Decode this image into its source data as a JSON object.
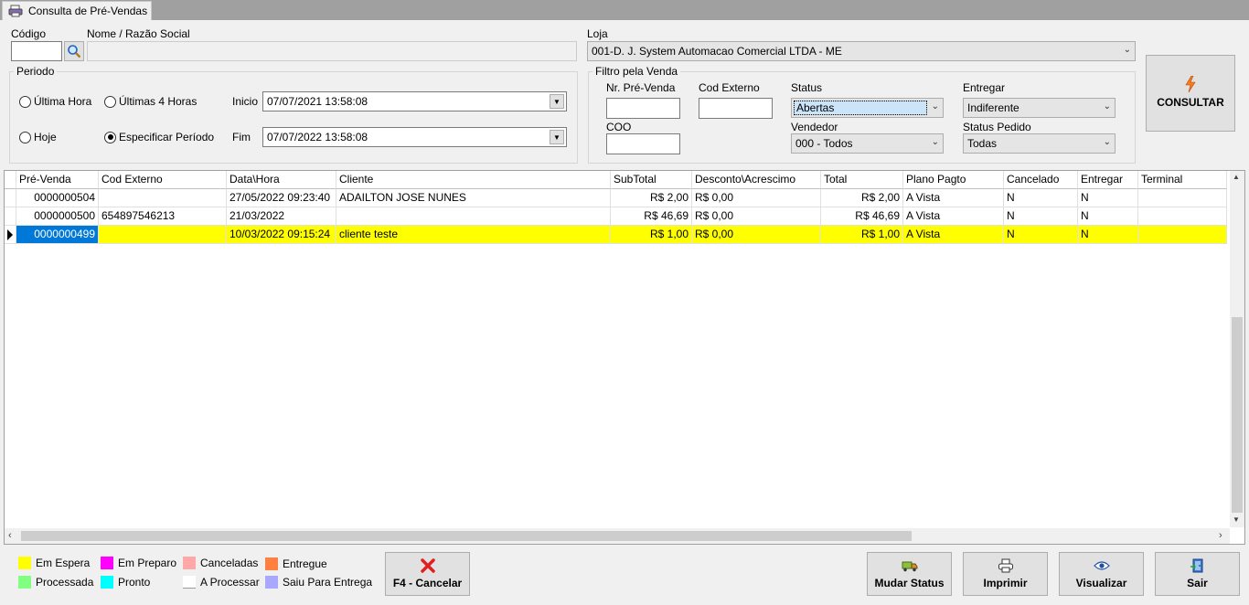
{
  "tab": {
    "title": "Consulta de  Pré-Vendas"
  },
  "codigo": {
    "label": "Código",
    "value": ""
  },
  "nome": {
    "label": "Nome / Razão Social",
    "value": ""
  },
  "loja": {
    "label": "Loja",
    "value": "001-D. J. System Automacao Comercial LTDA - ME"
  },
  "periodo": {
    "title": "Periodo",
    "options": [
      "Última Hora",
      "Últimas 4 Horas",
      "Hoje",
      "Especificar Período"
    ],
    "selected": "Especificar Período",
    "inicio_label": "Inicio",
    "inicio_value": "07/07/2021    13:58:08",
    "fim_label": "Fim",
    "fim_value": "07/07/2022    13:58:08"
  },
  "filtro": {
    "title": "Filtro pela Venda",
    "nr_label": "Nr. Pré-Venda",
    "nr_value": "",
    "codext_label": "Cod Externo",
    "codext_value": "",
    "coo_label": "COO",
    "coo_value": "",
    "status_label": "Status",
    "status_value": "Abertas",
    "vendedor_label": "Vendedor",
    "vendedor_value": "000 - Todos",
    "entregar_label": "Entregar",
    "entregar_value": "Indiferente",
    "statuspedido_label": "Status Pedido",
    "statuspedido_value": "Todas"
  },
  "consultar_label": "CONSULTAR",
  "grid": {
    "columns": [
      "Pré-Venda",
      "Cod Externo",
      "Data\\Hora",
      "Cliente",
      "SubTotal",
      "Desconto\\Acrescimo",
      "Total",
      "Plano Pagto",
      "Cancelado",
      "Entregar",
      "Terminal"
    ],
    "rows": [
      [
        "0000000504",
        "",
        "27/05/2022 09:23:40",
        "ADAILTON JOSE NUNES",
        "R$ 2,00",
        "R$ 0,00",
        "R$ 2,00",
        "A Vista",
        "N",
        "N",
        ""
      ],
      [
        "0000000500",
        "654897546213",
        "21/03/2022",
        "",
        "R$ 46,69",
        "R$ 0,00",
        "R$ 46,69",
        "A Vista",
        "N",
        "N",
        ""
      ],
      [
        "0000000499",
        "",
        "10/03/2022 09:15:24",
        "cliente teste",
        "R$ 1,00",
        "R$ 0,00",
        "R$ 1,00",
        "A Vista",
        "N",
        "N",
        ""
      ]
    ],
    "selected_row": 2
  },
  "legend": [
    {
      "label": "Em Espera",
      "color": "#ffff00"
    },
    {
      "label": "Processada",
      "color": "#80ff80"
    },
    {
      "label": "Em Preparo",
      "color": "#ff00ff"
    },
    {
      "label": "Pronto",
      "color": "#00ffff"
    },
    {
      "label": "Canceladas",
      "color": "#ffa8a8"
    },
    {
      "label": "A Processar",
      "color": "#ffffff"
    },
    {
      "label": "Entregue",
      "color": "#ff8040"
    },
    {
      "label": "Saiu Para Entrega",
      "color": "#a8a8ff"
    }
  ],
  "buttons": {
    "cancelar": "F4 - Cancelar",
    "mudar_status": "Mudar Status",
    "imprimir": "Imprimir",
    "visualizar": "Visualizar",
    "sair": "Sair"
  }
}
